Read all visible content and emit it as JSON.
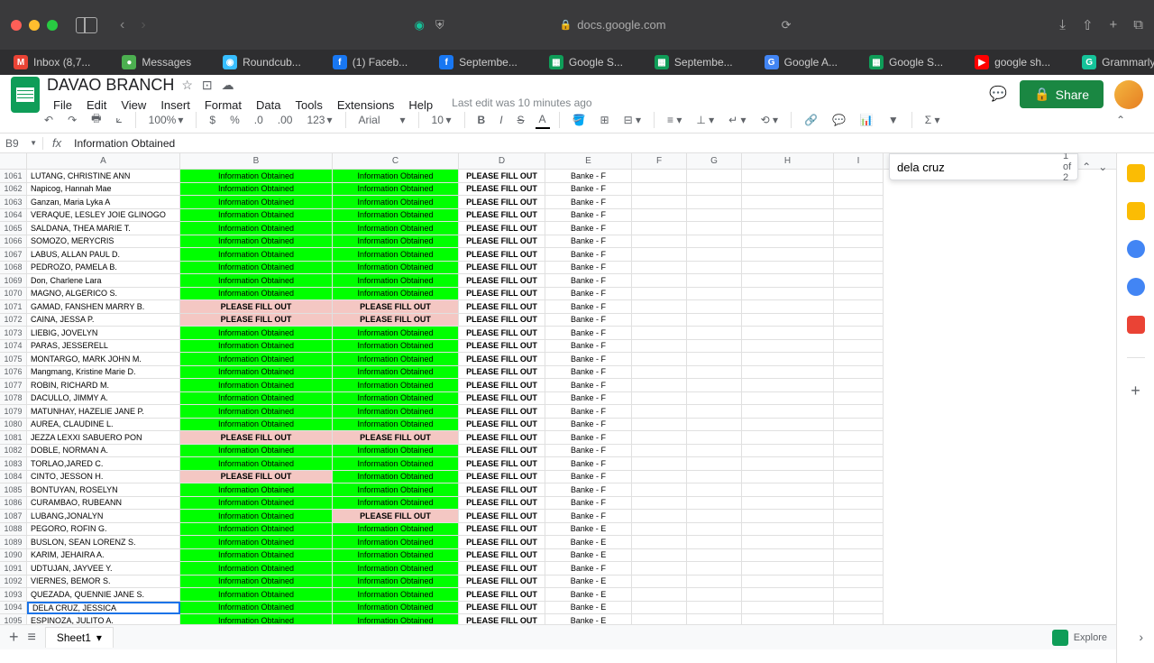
{
  "browser": {
    "url": "docs.google.com",
    "tabs": [
      {
        "icon": "M",
        "iconBg": "#ea4335",
        "label": "Inbox (8,7..."
      },
      {
        "icon": "●",
        "iconBg": "#4caf50",
        "label": "Messages"
      },
      {
        "icon": "◉",
        "iconBg": "#37beff",
        "label": "Roundcub..."
      },
      {
        "icon": "f",
        "iconBg": "#1877f2",
        "label": "(1) Faceb..."
      },
      {
        "icon": "f",
        "iconBg": "#1877f2",
        "label": "Septembe..."
      },
      {
        "icon": "▦",
        "iconBg": "#0f9d58",
        "label": "Google S..."
      },
      {
        "icon": "▦",
        "iconBg": "#0f9d58",
        "label": "Septembe..."
      },
      {
        "icon": "G",
        "iconBg": "#4285f4",
        "label": "Google A..."
      },
      {
        "icon": "▦",
        "iconBg": "#0f9d58",
        "label": "Google S..."
      },
      {
        "icon": "▶",
        "iconBg": "#ff0000",
        "label": "google sh..."
      },
      {
        "icon": "G",
        "iconBg": "#15c39a",
        "label": "Grammarly"
      }
    ]
  },
  "doc": {
    "title": "DAVAO BRANCH",
    "lastEdit": "Last edit was 10 minutes ago",
    "shareLabel": "Share"
  },
  "menu": [
    "File",
    "Edit",
    "View",
    "Insert",
    "Format",
    "Data",
    "Tools",
    "Extensions",
    "Help"
  ],
  "toolbar": {
    "zoom": "100%",
    "decimals": "123",
    "font": "Arial",
    "fontSize": "10"
  },
  "nameBox": "B9",
  "formula": "Information Obtained",
  "cols": [
    "A",
    "B",
    "C",
    "D",
    "E",
    "F",
    "G",
    "H",
    "I"
  ],
  "find": {
    "query": "dela cruz",
    "count": "1 of 2"
  },
  "rows": [
    {
      "n": 1061,
      "a": "LUTANG, CHRISTINE ANN",
      "b": "Information Obtained",
      "c": "Information Obtained",
      "d": "PLEASE FILL OUT",
      "e": "Banke - F"
    },
    {
      "n": 1062,
      "a": "Napicog, Hannah Mae",
      "b": "Information Obtained",
      "c": "Information Obtained",
      "d": "PLEASE FILL OUT",
      "e": "Banke - F"
    },
    {
      "n": 1063,
      "a": "Ganzan, Maria Lyka A",
      "b": "Information Obtained",
      "c": "Information Obtained",
      "d": "PLEASE FILL OUT",
      "e": "Banke - F"
    },
    {
      "n": 1064,
      "a": "VERAQUE, LESLEY JOIE GLINOGO",
      "b": "Information Obtained",
      "c": "Information Obtained",
      "d": "PLEASE FILL OUT",
      "e": "Banke - F"
    },
    {
      "n": 1065,
      "a": "SALDANA, THEA MARIE T.",
      "b": "Information Obtained",
      "c": "Information Obtained",
      "d": "PLEASE FILL OUT",
      "e": "Banke - F"
    },
    {
      "n": 1066,
      "a": "SOMOZO, MERYCRIS",
      "b": "Information Obtained",
      "c": "Information Obtained",
      "d": "PLEASE FILL OUT",
      "e": "Banke - F"
    },
    {
      "n": 1067,
      "a": "LABUS, ALLAN PAUL D.",
      "b": "Information Obtained",
      "c": "Information Obtained",
      "d": "PLEASE FILL OUT",
      "e": "Banke - F"
    },
    {
      "n": 1068,
      "a": "PEDROZO, PAMELA B.",
      "b": "Information Obtained",
      "c": "Information Obtained",
      "d": "PLEASE FILL OUT",
      "e": "Banke - F"
    },
    {
      "n": 1069,
      "a": "Don, Charlene Lara",
      "b": "Information Obtained",
      "c": "Information Obtained",
      "d": "PLEASE FILL OUT",
      "e": "Banke - F"
    },
    {
      "n": 1070,
      "a": "MAGNO, ALGERICO S.",
      "b": "Information Obtained",
      "c": "Information Obtained",
      "d": "PLEASE FILL OUT",
      "e": "Banke - F"
    },
    {
      "n": 1071,
      "a": "GAMAD, FANSHEN MARRY B.",
      "b": "PLEASE FILL OUT",
      "c": "PLEASE FILL OUT",
      "d": "PLEASE FILL OUT",
      "e": "Banke - F",
      "bp": true,
      "cp": true
    },
    {
      "n": 1072,
      "a": "CAINA, JESSA P.",
      "b": "PLEASE FILL OUT",
      "c": "PLEASE FILL OUT",
      "d": "PLEASE FILL OUT",
      "e": "Banke - F",
      "bp": true,
      "cp": true
    },
    {
      "n": 1073,
      "a": "LIEBIG, JOVELYN",
      "b": "Information Obtained",
      "c": "Information Obtained",
      "d": "PLEASE FILL OUT",
      "e": "Banke - F"
    },
    {
      "n": 1074,
      "a": "PARAS, JESSERELL",
      "b": "Information Obtained",
      "c": "Information Obtained",
      "d": "PLEASE FILL OUT",
      "e": "Banke - F"
    },
    {
      "n": 1075,
      "a": "MONTARGO, MARK JOHN M.",
      "b": "Information Obtained",
      "c": "Information Obtained",
      "d": "PLEASE FILL OUT",
      "e": "Banke - F"
    },
    {
      "n": 1076,
      "a": "Mangmang, Kristine Marie D.",
      "b": "Information Obtained",
      "c": "Information Obtained",
      "d": "PLEASE FILL OUT",
      "e": "Banke - F"
    },
    {
      "n": 1077,
      "a": "ROBIN, RICHARD M.",
      "b": "Information Obtained",
      "c": "Information Obtained",
      "d": "PLEASE FILL OUT",
      "e": "Banke - F"
    },
    {
      "n": 1078,
      "a": "DACULLO, JIMMY A.",
      "b": "Information Obtained",
      "c": "Information Obtained",
      "d": "PLEASE FILL OUT",
      "e": "Banke - F"
    },
    {
      "n": 1079,
      "a": "MATUNHAY, HAZELIE JANE P.",
      "b": "Information Obtained",
      "c": "Information Obtained",
      "d": "PLEASE FILL OUT",
      "e": "Banke - F"
    },
    {
      "n": 1080,
      "a": "AUREA, CLAUDINE L.",
      "b": "Information Obtained",
      "c": "Information Obtained",
      "d": "PLEASE FILL OUT",
      "e": "Banke - F"
    },
    {
      "n": 1081,
      "a": "JEZZA LEXXI SABUERO PON",
      "b": "PLEASE FILL OUT",
      "c": "PLEASE FILL OUT",
      "d": "PLEASE FILL OUT",
      "e": "Banke - F",
      "bp": true,
      "cp": true
    },
    {
      "n": 1082,
      "a": "DOBLE, NORMAN A.",
      "b": "Information Obtained",
      "c": "Information Obtained",
      "d": "PLEASE FILL OUT",
      "e": "Banke - F"
    },
    {
      "n": 1083,
      "a": "TORLAO,JARED C.",
      "b": "Information Obtained",
      "c": "Information Obtained",
      "d": "PLEASE FILL OUT",
      "e": "Banke - F"
    },
    {
      "n": 1084,
      "a": "CINTO, JESSON H.",
      "b": "PLEASE FILL OUT",
      "c": "Information Obtained",
      "d": "PLEASE FILL OUT",
      "e": "Banke - F",
      "bp": true
    },
    {
      "n": 1085,
      "a": "BONTUYAN, ROSELYN",
      "b": "Information Obtained",
      "c": "Information Obtained",
      "d": "PLEASE FILL OUT",
      "e": "Banke - F"
    },
    {
      "n": 1086,
      "a": "CURAMBAO, RUBEANN",
      "b": "Information Obtained",
      "c": "Information Obtained",
      "d": "PLEASE FILL OUT",
      "e": "Banke - F"
    },
    {
      "n": 1087,
      "a": "LUBANG,JONALYN",
      "b": "Information Obtained",
      "c": "PLEASE FILL OUT",
      "d": "PLEASE FILL OUT",
      "e": "Banke - F",
      "cp": true
    },
    {
      "n": 1088,
      "a": "PEGORO, ROFIN G.",
      "b": "Information Obtained",
      "c": "Information Obtained",
      "d": "PLEASE FILL OUT",
      "e": "Banke - E"
    },
    {
      "n": 1089,
      "a": "BUSLON, SEAN LORENZ S.",
      "b": "Information Obtained",
      "c": "Information Obtained",
      "d": "PLEASE FILL OUT",
      "e": "Banke - E"
    },
    {
      "n": 1090,
      "a": "KARIM, JEHAIRA A.",
      "b": "Information Obtained",
      "c": "Information Obtained",
      "d": "PLEASE FILL OUT",
      "e": "Banke - E"
    },
    {
      "n": 1091,
      "a": "UDTUJAN, JAYVEE Y.",
      "b": "Information Obtained",
      "c": "Information Obtained",
      "d": "PLEASE FILL OUT",
      "e": "Banke - F"
    },
    {
      "n": 1092,
      "a": "VIERNES, BEMOR  S.",
      "b": "Information Obtained",
      "c": "Information Obtained",
      "d": "PLEASE FILL OUT",
      "e": "Banke - E"
    },
    {
      "n": 1093,
      "a": "QUEZADA, QUENNIE JANE S.",
      "b": "Information Obtained",
      "c": "Information Obtained",
      "d": "PLEASE FILL OUT",
      "e": "Banke - E"
    },
    {
      "n": 1094,
      "a": "DELA CRUZ, JESSICA",
      "b": "Information Obtained",
      "c": "Information Obtained",
      "d": "PLEASE FILL OUT",
      "e": "Banke - E",
      "sel": true
    },
    {
      "n": 1095,
      "a": "ESPINOZA, JULITO A.",
      "b": "Information Obtained",
      "c": "Information Obtained",
      "d": "PLEASE FILL OUT",
      "e": "Banke - E"
    }
  ],
  "sheet": {
    "name": "Sheet1"
  },
  "explore": "Explore"
}
